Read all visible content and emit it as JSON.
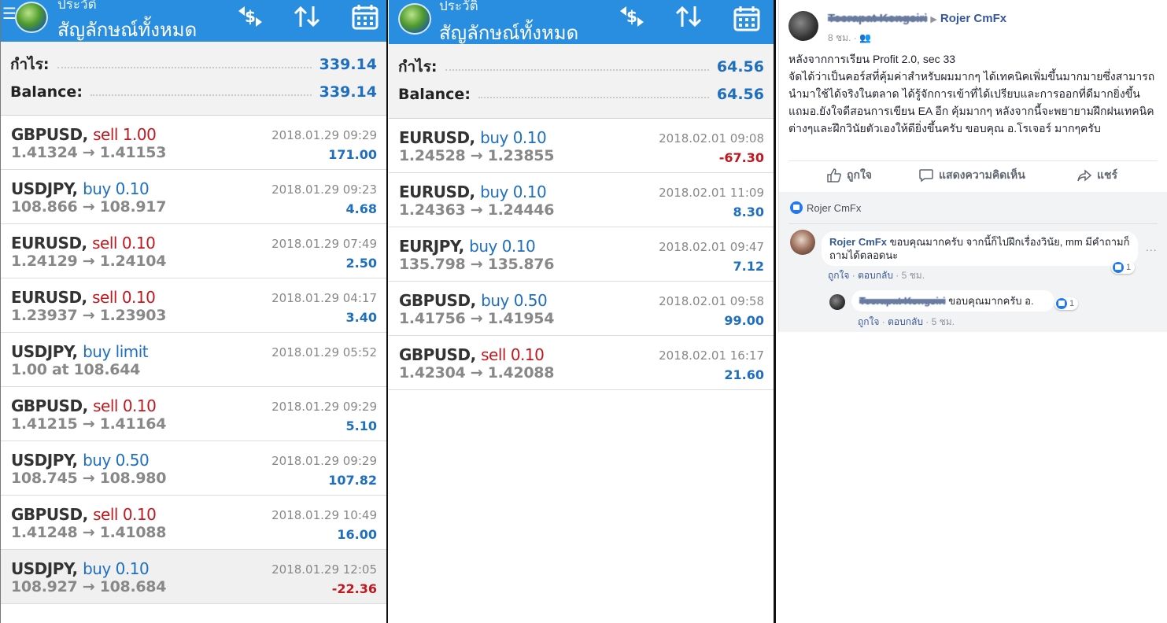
{
  "colors": {
    "header_blue": "#2a8ee0",
    "sell_red": "#c0181e",
    "buy_blue": "#1f6fc0",
    "fb_link": "#365899"
  },
  "panel1": {
    "subtitle": "ประวัติ",
    "title": "สัญลักษณ์ทั้งหมด",
    "menu_icon": "hamburger-icon",
    "profit_label": "กำไร:",
    "profit_value": "339.14",
    "balance_label": "Balance:",
    "balance_value": "339.14",
    "trades": [
      {
        "symbol": "GBPUSD,",
        "side": "sell 1.00",
        "type": "sell",
        "prices": "1.41324 → 1.41153",
        "time": "2018.01.29 09:29",
        "pl": "171.00",
        "neg": false
      },
      {
        "symbol": "USDJPY,",
        "side": "buy 0.10",
        "type": "buy",
        "prices": "108.866 → 108.917",
        "time": "2018.01.29 09:23",
        "pl": "4.68",
        "neg": false
      },
      {
        "symbol": "EURUSD,",
        "side": "sell 0.10",
        "type": "sell",
        "prices": "1.24129 → 1.24104",
        "time": "2018.01.29 07:49",
        "pl": "2.50",
        "neg": false
      },
      {
        "symbol": "EURUSD,",
        "side": "sell 0.10",
        "type": "sell",
        "prices": "1.23937 → 1.23903",
        "time": "2018.01.29 04:17",
        "pl": "3.40",
        "neg": false
      },
      {
        "symbol": "USDJPY,",
        "side": "buy limit",
        "type": "buy",
        "prices": "1.00 at 108.644",
        "time": "2018.01.29 05:52",
        "pl": "",
        "neg": false
      },
      {
        "symbol": "GBPUSD,",
        "side": "sell 0.10",
        "type": "sell",
        "prices": "1.41215 → 1.41164",
        "time": "2018.01.29 09:29",
        "pl": "5.10",
        "neg": false
      },
      {
        "symbol": "USDJPY,",
        "side": "buy 0.50",
        "type": "buy",
        "prices": "108.745 → 108.980",
        "time": "2018.01.29 09:29",
        "pl": "107.82",
        "neg": false
      },
      {
        "symbol": "GBPUSD,",
        "side": "sell 0.10",
        "type": "sell",
        "prices": "1.41248 → 1.41088",
        "time": "2018.01.29 10:49",
        "pl": "16.00",
        "neg": false
      },
      {
        "symbol": "USDJPY,",
        "side": "buy 0.10",
        "type": "buy",
        "prices": "108.927 → 108.684",
        "time": "2018.01.29 12:05",
        "pl": "-22.36",
        "neg": true
      }
    ]
  },
  "panel2": {
    "subtitle": "ประวัติ",
    "title": "สัญลักษณ์ทั้งหมด",
    "profit_label": "กำไร:",
    "profit_value": "64.56",
    "balance_label": "Balance:",
    "balance_value": "64.56",
    "trades": [
      {
        "symbol": "EURUSD,",
        "side": "buy 0.10",
        "type": "buy",
        "prices": "1.24528 → 1.23855",
        "time": "2018.02.01 09:08",
        "pl": "-67.30",
        "neg": true
      },
      {
        "symbol": "EURUSD,",
        "side": "buy 0.10",
        "type": "buy",
        "prices": "1.24363 → 1.24446",
        "time": "2018.02.01 11:09",
        "pl": "8.30",
        "neg": false
      },
      {
        "symbol": "EURJPY,",
        "side": "buy 0.10",
        "type": "buy",
        "prices": "135.798 → 135.876",
        "time": "2018.02.01 09:47",
        "pl": "7.12",
        "neg": false
      },
      {
        "symbol": "GBPUSD,",
        "side": "buy 0.50",
        "type": "buy",
        "prices": "1.41756 → 1.41954",
        "time": "2018.02.01 09:58",
        "pl": "99.00",
        "neg": false
      },
      {
        "symbol": "GBPUSD,",
        "side": "sell 0.10",
        "type": "sell",
        "prices": "1.42304 → 1.42088",
        "time": "2018.02.01 16:17",
        "pl": "21.60",
        "neg": false
      }
    ]
  },
  "header_icons": [
    "currency-exchange-icon",
    "sort-icon",
    "calendar-icon"
  ],
  "facebook": {
    "author": "Teerapat Kongsiri",
    "target": "Rojer CmFx",
    "time": "8 ชม.",
    "audience_icon": "friends-icon",
    "body": [
      "หลังจากการเรียน Profit 2.0, sec 33",
      "จัดได้ว่าเป็นคอร์สที่คุ้มค่าสำหรับผมมากๆ ได้เทคนิคเพิ่มขึ้นมากมายซึ่งสามารถนำมาใช้ได้จริงในตลาด ได้รู้จักการเข้าที่ได้เปรียบและการออกที่ดีมากยิ่งขึ้น แถมอ.ยังใจดีสอนการเขียน EA อีก คุ้มมากๆ หลังจากนี้จะพยายามฝึกฝนเทคนิคต่างๆและฝึกวินัยตัวเองให้ดียิ่งขึ้นครับ ขอบคุณ อ.โรเจอร์ มากๆครับ"
    ],
    "actions": {
      "like": "ถูกใจ",
      "comment": "แสดงความคิดเห็น",
      "share": "แชร์"
    },
    "liked_by": "Rojer CmFx",
    "comments": [
      {
        "name": "Rojer CmFx",
        "text": "ขอบคุณมากครับ จากนี้ก็ไปฝึกเรื่องวินัย, mm มีคำถามก็ถามได้ตลอดนะ",
        "like": "ถูกใจ",
        "reply": "ตอบกลับ",
        "time": "5 ชม.",
        "reactions": "1"
      },
      {
        "name": "Teerapat Kongsiri",
        "text": "ขอบคุณมากครับ อ.",
        "like": "ถูกใจ",
        "reply": "ตอบกลับ",
        "time": "5 ชม.",
        "reactions": "1"
      }
    ],
    "more": "..."
  }
}
